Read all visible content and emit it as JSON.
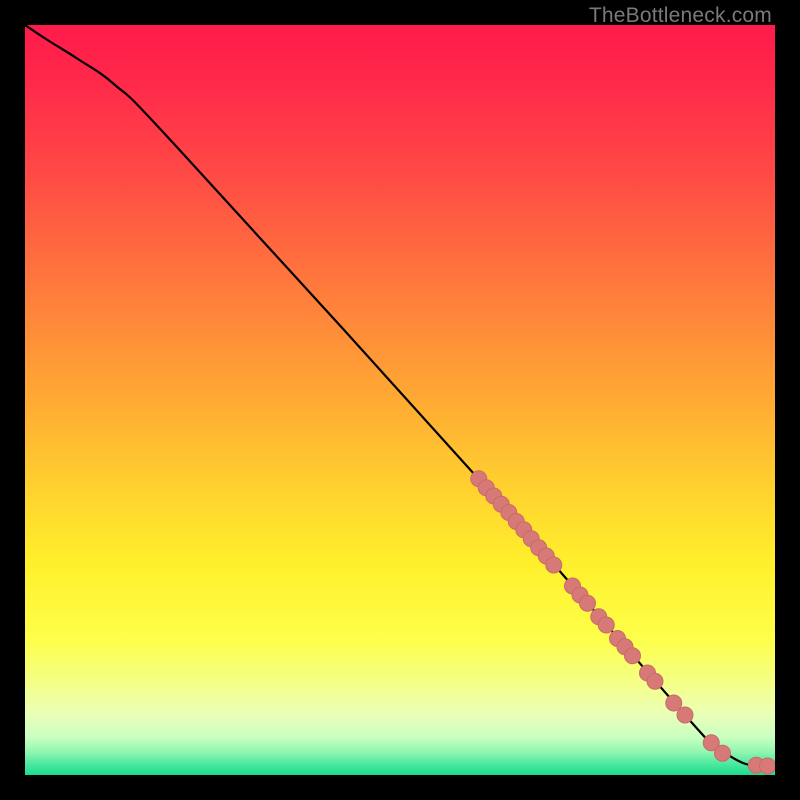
{
  "watermark": "TheBottleneck.com",
  "colors": {
    "background": "#000000",
    "curve": "#000000",
    "point_fill": "#d77a77",
    "point_stroke": "#c86b68",
    "gradient_stops": [
      {
        "offset": "0%",
        "color": "#ff1a4b"
      },
      {
        "offset": "8%",
        "color": "#ff2a4a"
      },
      {
        "offset": "20%",
        "color": "#ff4a45"
      },
      {
        "offset": "35%",
        "color": "#ff7a3c"
      },
      {
        "offset": "50%",
        "color": "#ffaa33"
      },
      {
        "offset": "62%",
        "color": "#ffd22e"
      },
      {
        "offset": "72%",
        "color": "#fff02c"
      },
      {
        "offset": "82%",
        "color": "#fdff4a"
      },
      {
        "offset": "88%",
        "color": "#f4ff8a"
      },
      {
        "offset": "92%",
        "color": "#e9ffb8"
      },
      {
        "offset": "95%",
        "color": "#c9ffc0"
      },
      {
        "offset": "97%",
        "color": "#8ef5b0"
      },
      {
        "offset": "98.5%",
        "color": "#4ee9a0"
      },
      {
        "offset": "100%",
        "color": "#18dd8e"
      }
    ]
  },
  "chart_data": {
    "type": "line",
    "title": "",
    "xlabel": "",
    "ylabel": "",
    "xlim": [
      0,
      100
    ],
    "ylim": [
      0,
      100
    ],
    "series": [
      {
        "name": "curve",
        "x": [
          0,
          3,
          7,
          12,
          20,
          60,
          88,
          92,
          96,
          100
        ],
        "y": [
          100,
          98,
          95.5,
          92,
          84,
          40,
          8,
          4,
          1.5,
          1.2
        ]
      }
    ],
    "points": [
      {
        "x": 60.5,
        "y": 39.5
      },
      {
        "x": 61.5,
        "y": 38.3
      },
      {
        "x": 62.5,
        "y": 37.2
      },
      {
        "x": 63.5,
        "y": 36.1
      },
      {
        "x": 64.5,
        "y": 35.0
      },
      {
        "x": 65.5,
        "y": 33.8
      },
      {
        "x": 66.5,
        "y": 32.7
      },
      {
        "x": 67.5,
        "y": 31.5
      },
      {
        "x": 68.5,
        "y": 30.3
      },
      {
        "x": 69.5,
        "y": 29.2
      },
      {
        "x": 70.5,
        "y": 28.0
      },
      {
        "x": 73.0,
        "y": 25.2
      },
      {
        "x": 74.0,
        "y": 24.0
      },
      {
        "x": 75.0,
        "y": 22.9
      },
      {
        "x": 76.5,
        "y": 21.1
      },
      {
        "x": 77.5,
        "y": 20.0
      },
      {
        "x": 79.0,
        "y": 18.2
      },
      {
        "x": 80.0,
        "y": 17.1
      },
      {
        "x": 81.0,
        "y": 15.9
      },
      {
        "x": 83.0,
        "y": 13.6
      },
      {
        "x": 84.0,
        "y": 12.5
      },
      {
        "x": 86.5,
        "y": 9.6
      },
      {
        "x": 88.0,
        "y": 8.0
      },
      {
        "x": 91.5,
        "y": 4.3
      },
      {
        "x": 93.0,
        "y": 2.9
      },
      {
        "x": 97.5,
        "y": 1.3
      },
      {
        "x": 99.0,
        "y": 1.2
      }
    ],
    "point_radius_px": 8
  }
}
